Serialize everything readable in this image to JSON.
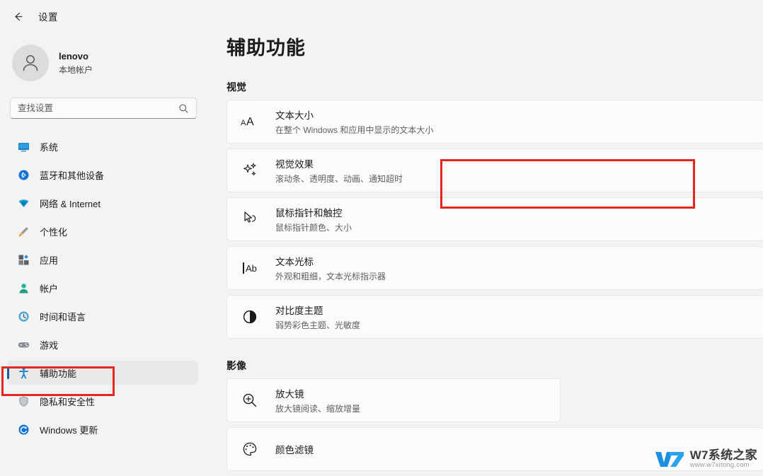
{
  "window": {
    "title": "设置",
    "back_label": "back-arrow"
  },
  "account": {
    "name": "lenovo",
    "type": "本地帐户",
    "avatar_icon": "person-icon"
  },
  "search": {
    "placeholder": "查找设置",
    "value": "",
    "icon": "search-icon"
  },
  "sidebar": {
    "items": [
      {
        "label": "系统",
        "icon": "display-icon",
        "selected": false
      },
      {
        "label": "蓝牙和其他设备",
        "icon": "bluetooth-icon",
        "selected": false
      },
      {
        "label": "网络 & Internet",
        "icon": "wifi-icon",
        "selected": false
      },
      {
        "label": "个性化",
        "icon": "paintbrush-icon",
        "selected": false
      },
      {
        "label": "应用",
        "icon": "apps-icon",
        "selected": false
      },
      {
        "label": "帐户",
        "icon": "account-icon",
        "selected": false
      },
      {
        "label": "时间和语言",
        "icon": "clock-icon",
        "selected": false
      },
      {
        "label": "游戏",
        "icon": "gamepad-icon",
        "selected": false
      },
      {
        "label": "辅助功能",
        "icon": "accessibility-icon",
        "selected": true
      },
      {
        "label": "隐私和安全性",
        "icon": "shield-icon",
        "selected": false
      },
      {
        "label": "Windows 更新",
        "icon": "update-icon",
        "selected": false
      }
    ]
  },
  "main": {
    "page_title": "辅助功能",
    "sections": [
      {
        "heading": "视觉",
        "cards": [
          {
            "title": "文本大小",
            "sub": "在整个 Windows 和应用中显示的文本大小",
            "icon": "text-size-icon",
            "highlighted": false,
            "narrow": false
          },
          {
            "title": "视觉效果",
            "sub": "滚动条、透明度、动画、通知超时",
            "icon": "sparkle-icon",
            "highlighted": true,
            "narrow": false
          },
          {
            "title": "鼠标指针和触控",
            "sub": "鼠标指针颜色、大小",
            "icon": "mouse-pointer-icon",
            "highlighted": false,
            "narrow": false
          },
          {
            "title": "文本光标",
            "sub": "外观和粗细，文本光标指示器",
            "icon": "text-cursor-icon",
            "highlighted": false,
            "narrow": false
          },
          {
            "title": "对比度主题",
            "sub": "弱势彩色主题、光敏度",
            "icon": "contrast-icon",
            "highlighted": false,
            "narrow": false
          }
        ]
      },
      {
        "heading": "影像",
        "cards": [
          {
            "title": "放大镜",
            "sub": "放大镜阅读、缩放增量",
            "icon": "magnifier-icon",
            "highlighted": false,
            "narrow": true
          },
          {
            "title": "颜色滤镜",
            "sub": "",
            "icon": "color-filter-icon",
            "highlighted": false,
            "narrow": false
          }
        ]
      }
    ]
  },
  "annotations": {
    "accent_red": "#e8241f",
    "selection_indicator": "#0f5fa6",
    "boxes": [
      {
        "target": "辅助功能"
      },
      {
        "target": "视觉效果"
      }
    ]
  },
  "watermark": {
    "name": "W7系统之家",
    "url": "www.w7xitong.com"
  }
}
